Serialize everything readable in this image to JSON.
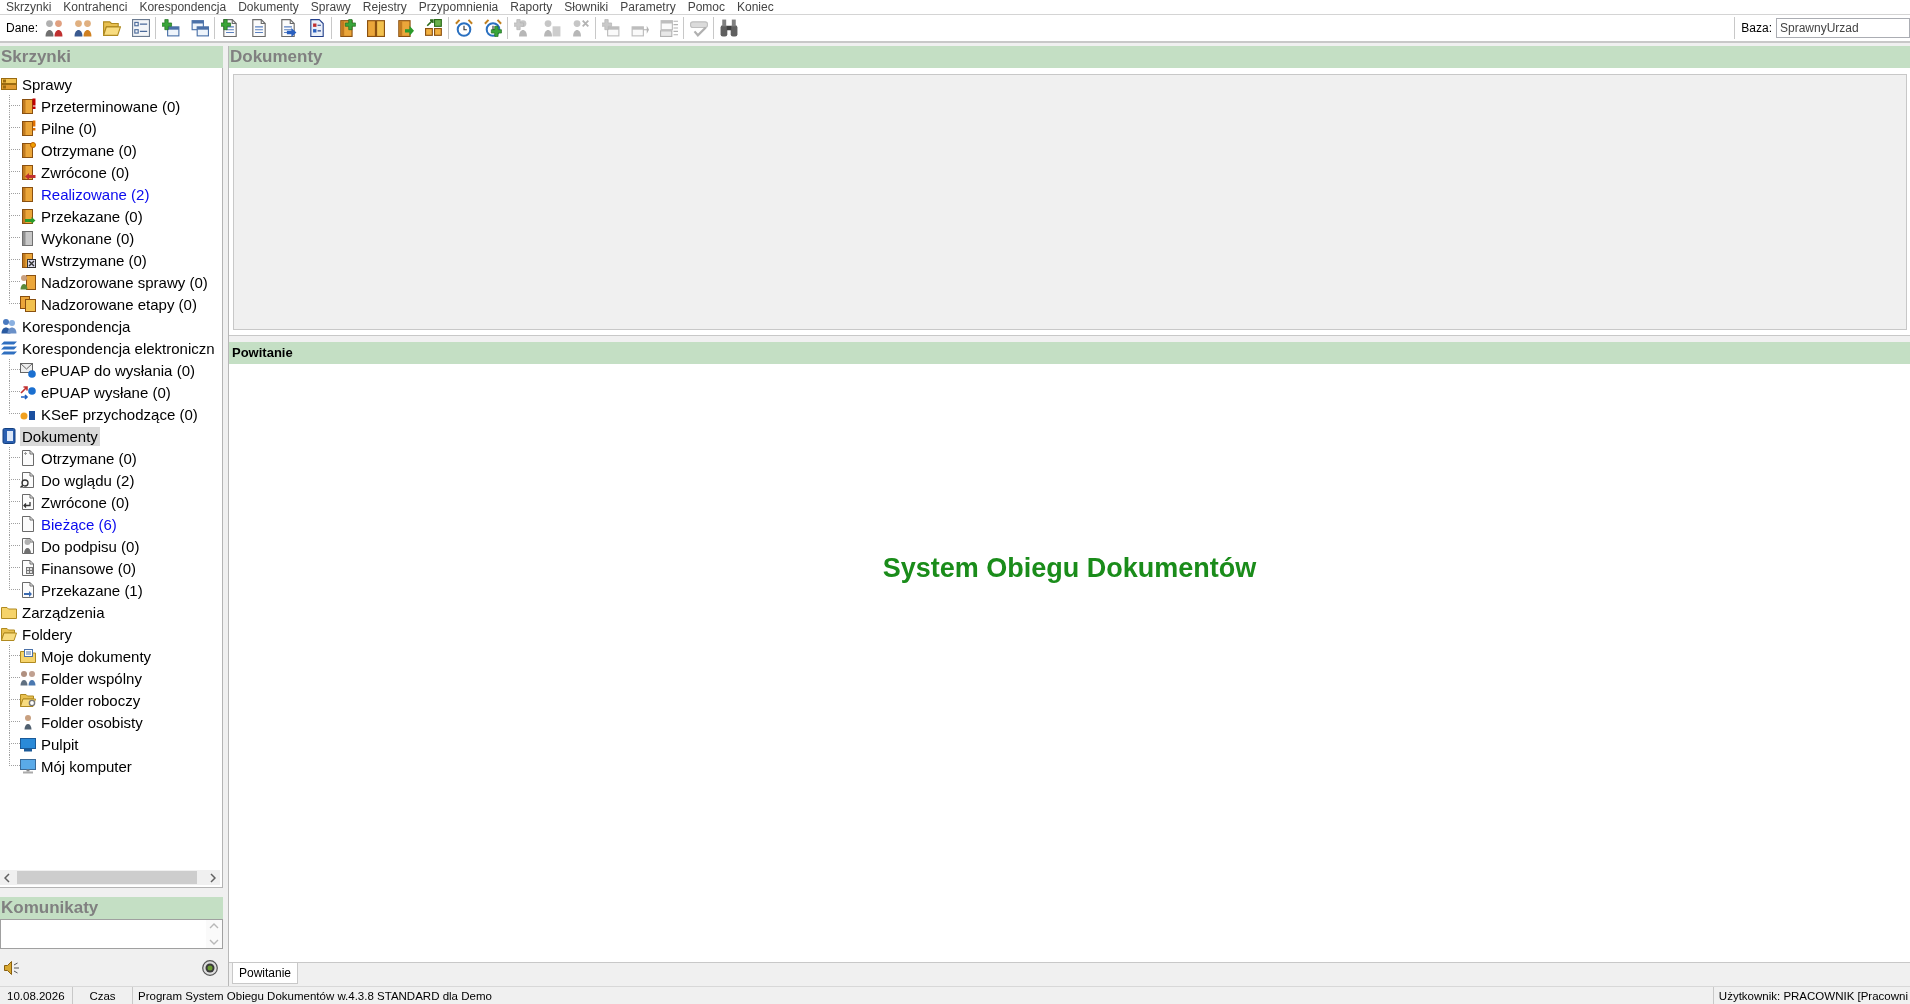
{
  "menu": [
    "Skrzynki",
    "Kontrahenci",
    "Korespondencja",
    "Dokumenty",
    "Sprawy",
    "Rejestry",
    "Przypomnienia",
    "Raporty",
    "Słowniki",
    "Parametry",
    "Pomoc",
    "Koniec"
  ],
  "toolbar": {
    "label": "Dane:",
    "groups": [
      {
        "buttons": [
          {
            "disabled": false
          },
          {
            "disabled": false
          },
          {
            "disabled": false
          },
          {
            "disabled": false
          }
        ]
      },
      {
        "buttons": [
          {
            "disabled": false
          },
          {
            "disabled": false
          }
        ]
      },
      {
        "buttons": [
          {
            "disabled": false
          },
          {
            "disabled": false
          },
          {
            "disabled": false
          },
          {
            "disabled": false
          }
        ]
      },
      {
        "buttons": [
          {
            "disabled": false
          },
          {
            "disabled": false
          },
          {
            "disabled": false
          },
          {
            "disabled": false
          }
        ]
      },
      {
        "buttons": [
          {
            "disabled": false
          },
          {
            "disabled": false
          }
        ]
      },
      {
        "buttons": [
          {
            "disabled": true
          },
          {
            "disabled": true
          },
          {
            "disabled": true
          }
        ]
      },
      {
        "buttons": [
          {
            "disabled": true
          },
          {
            "disabled": true
          },
          {
            "disabled": true
          }
        ]
      },
      {
        "buttons": [
          {
            "disabled": true
          }
        ]
      },
      {
        "buttons": [
          {
            "disabled": false
          }
        ]
      }
    ],
    "database": {
      "label": "Baza:",
      "value": "SprawnyUrzad"
    }
  },
  "sidebar": {
    "title": "Skrzynki",
    "tree": [
      {
        "label": "Sprawy",
        "selected": false,
        "highlighted": false,
        "children": [
          {
            "label": "Przeterminowane (0)",
            "selected": false,
            "highlighted": false
          },
          {
            "label": "Pilne (0)",
            "selected": false,
            "highlighted": false
          },
          {
            "label": "Otrzymane (0)",
            "selected": false,
            "highlighted": false
          },
          {
            "label": "Zwrócone (0)",
            "selected": false,
            "highlighted": false
          },
          {
            "label": "Realizowane (2)",
            "selected": false,
            "highlighted": true
          },
          {
            "label": "Przekazane (0)",
            "selected": false,
            "highlighted": false
          },
          {
            "label": "Wykonane (0)",
            "selected": false,
            "highlighted": false
          },
          {
            "label": "Wstrzymane (0)",
            "selected": false,
            "highlighted": false
          },
          {
            "label": "Nadzorowane sprawy (0)",
            "selected": false,
            "highlighted": false
          },
          {
            "label": "Nadzorowane etapy (0)",
            "selected": false,
            "highlighted": false
          }
        ]
      },
      {
        "label": "Korespondencja",
        "selected": false,
        "highlighted": false
      },
      {
        "label": "Korespondencja elektroniczn",
        "selected": false,
        "highlighted": false,
        "children": [
          {
            "label": "ePUAP do wysłania (0)",
            "selected": false,
            "highlighted": false
          },
          {
            "label": "ePUAP wysłane (0)",
            "selected": false,
            "highlighted": false
          },
          {
            "label": "KSeF przychodzące (0)",
            "selected": false,
            "highlighted": false
          }
        ]
      },
      {
        "label": "Dokumenty",
        "selected": true,
        "highlighted": false,
        "children": [
          {
            "label": "Otrzymane (0)",
            "selected": false,
            "highlighted": false
          },
          {
            "label": "Do wglądu (2)",
            "selected": false,
            "highlighted": false
          },
          {
            "label": "Zwrócone (0)",
            "selected": false,
            "highlighted": false
          },
          {
            "label": "Bieżące (6)",
            "selected": false,
            "highlighted": true
          },
          {
            "label": "Do podpisu (0)",
            "selected": false,
            "highlighted": false
          },
          {
            "label": "Finansowe (0)",
            "selected": false,
            "highlighted": false
          },
          {
            "label": "Przekazane (1)",
            "selected": false,
            "highlighted": false
          }
        ]
      },
      {
        "label": "Zarządzenia",
        "selected": false,
        "highlighted": false
      },
      {
        "label": "Foldery",
        "selected": false,
        "highlighted": false,
        "children": [
          {
            "label": "Moje dokumenty",
            "selected": false,
            "highlighted": false
          },
          {
            "label": "Folder wspólny",
            "selected": false,
            "highlighted": false
          },
          {
            "label": "Folder roboczy",
            "selected": false,
            "highlighted": false
          },
          {
            "label": "Folder osobisty",
            "selected": false,
            "highlighted": false
          },
          {
            "label": "Pulpit",
            "selected": false,
            "highlighted": false
          },
          {
            "label": "Mój komputer",
            "selected": false,
            "highlighted": false
          }
        ]
      }
    ]
  },
  "messages": {
    "title": "Komunikaty"
  },
  "documents_panel": {
    "title": "Dokumenty"
  },
  "welcome_panel": {
    "title": "Powitanie",
    "heading": "System Obiegu Dokumentów"
  },
  "bottom_tabs": [
    {
      "label": "Powitanie",
      "selected": true
    }
  ],
  "status_bar": {
    "cells": [
      "10.08.2026",
      "Czas",
      "Program System Obiegu Dokumentów w.4.3.8 STANDARD dla Demo"
    ],
    "user": "Użytkownik: PRACOWNIK [Pracowni"
  }
}
